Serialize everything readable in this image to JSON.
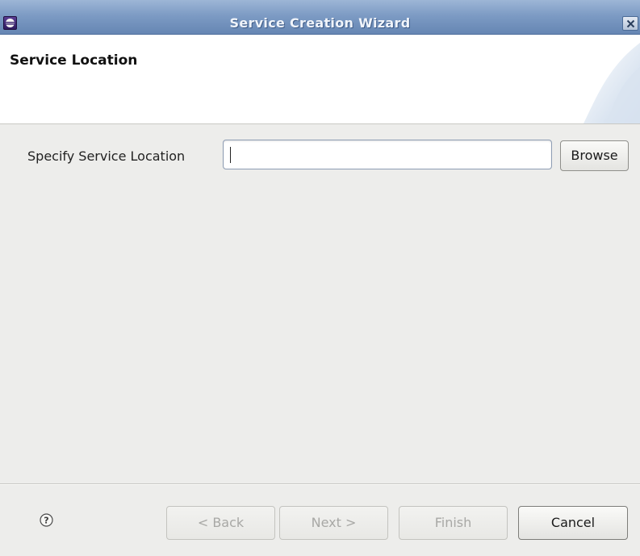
{
  "window": {
    "title": "Service Creation Wizard",
    "app_icon": "eclipse-icon",
    "close_icon": "close-icon"
  },
  "header": {
    "title": "Service Location"
  },
  "form": {
    "location_label": "Specify Service Location",
    "location_value": "",
    "browse_label": "Browse"
  },
  "footer": {
    "help_icon": "help-icon",
    "back_label": "< Back",
    "next_label": "Next >",
    "finish_label": "Finish",
    "cancel_label": "Cancel"
  },
  "colors": {
    "titlebar": "#7d9bc4",
    "background": "#ededeb",
    "header_bg": "#ffffff"
  }
}
